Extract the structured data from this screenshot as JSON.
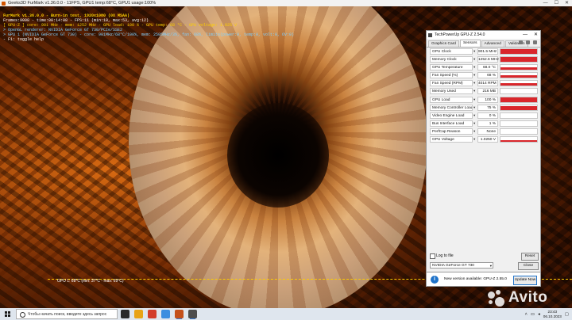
{
  "window_title": "Geeks3D FurMark v1.36.0.0 - 11FPS, GPU1 temp:68°C, GPU1 usage:100%",
  "osd": {
    "line1": "FurMark v1.36.0.0 - Burn-in test, 1920x1080 (0X MSAA)",
    "line2": "Frames:9098 - time:00:14:08 - FPS:11 (min:10, max:53, avg:12)",
    "line3": "[ GPU-Z ] core: 901 MHz - mem: 1252 MHz - GPU load: 100 % - GPU temp: 68 °C - GPU voltage: 1.025 V",
    "line4": "> OpenGL renderer: NVIDIA GeForce GT 730/PCIe/SSE2",
    "line5": "> GPU 1 (NVIDIA GeForce GT 730) - core: 901MHz/68°C/100%, mem: 2505MHz/3%, fan: 68%, limits(power:0, temp:0, volt:0, OV:0)",
    "line6": "- F1: toggle help",
    "graph_label": "GPU 1: 68°C (min: 37°C - max: 69°C)"
  },
  "gpuz": {
    "title": "TechPowerUp GPU-Z 2.54.0",
    "tabs": [
      "Graphics Card",
      "Sensors",
      "Advanced",
      "Validation"
    ],
    "active_tab": "Sensors",
    "sensors": [
      {
        "label": "GPU Clock",
        "value": "901.5 MHz",
        "level": 0.95
      },
      {
        "label": "Memory Clock",
        "value": "1252.6 MHz",
        "level": 0.95
      },
      {
        "label": "GPU Temperature",
        "value": "68.0 °C",
        "level": 0.6
      },
      {
        "label": "Fan Speed (%)",
        "value": "68 %",
        "level": 0.55
      },
      {
        "label": "Fan Speed (RPM)",
        "value": "4014 RPM",
        "level": 0.55
      },
      {
        "label": "Memory Used",
        "value": "216 MB",
        "level": 0.1
      },
      {
        "label": "GPU Load",
        "value": "100 %",
        "level": 0.95
      },
      {
        "label": "Memory Controller Load",
        "value": "75 %",
        "level": 0.75
      },
      {
        "label": "Video Engine Load",
        "value": "0 %",
        "level": 0
      },
      {
        "label": "Bus Interface Load",
        "value": "1 %",
        "level": 0
      },
      {
        "label": "PerfCap Reason",
        "value": "None",
        "level": 0
      },
      {
        "label": "GPU Voltage",
        "value": "1.0250 V",
        "level": 0.3
      }
    ],
    "log_label": "Log to file",
    "reset_label": "Reset",
    "gpu_select": "NVIDIA GeForce GT 730",
    "close_label": "Close",
    "update_message": "New version available: GPU-Z 2.55.0",
    "update_button": "Update Now"
  },
  "watermark": "Avito",
  "taskbar": {
    "search_placeholder": "Чтобы начать поиск, введите здесь запрос",
    "time": "23:43",
    "date": "06.10.2023",
    "colors": {
      "accent": "#3a7bd5",
      "sensor_bar": "#d9262b"
    }
  }
}
